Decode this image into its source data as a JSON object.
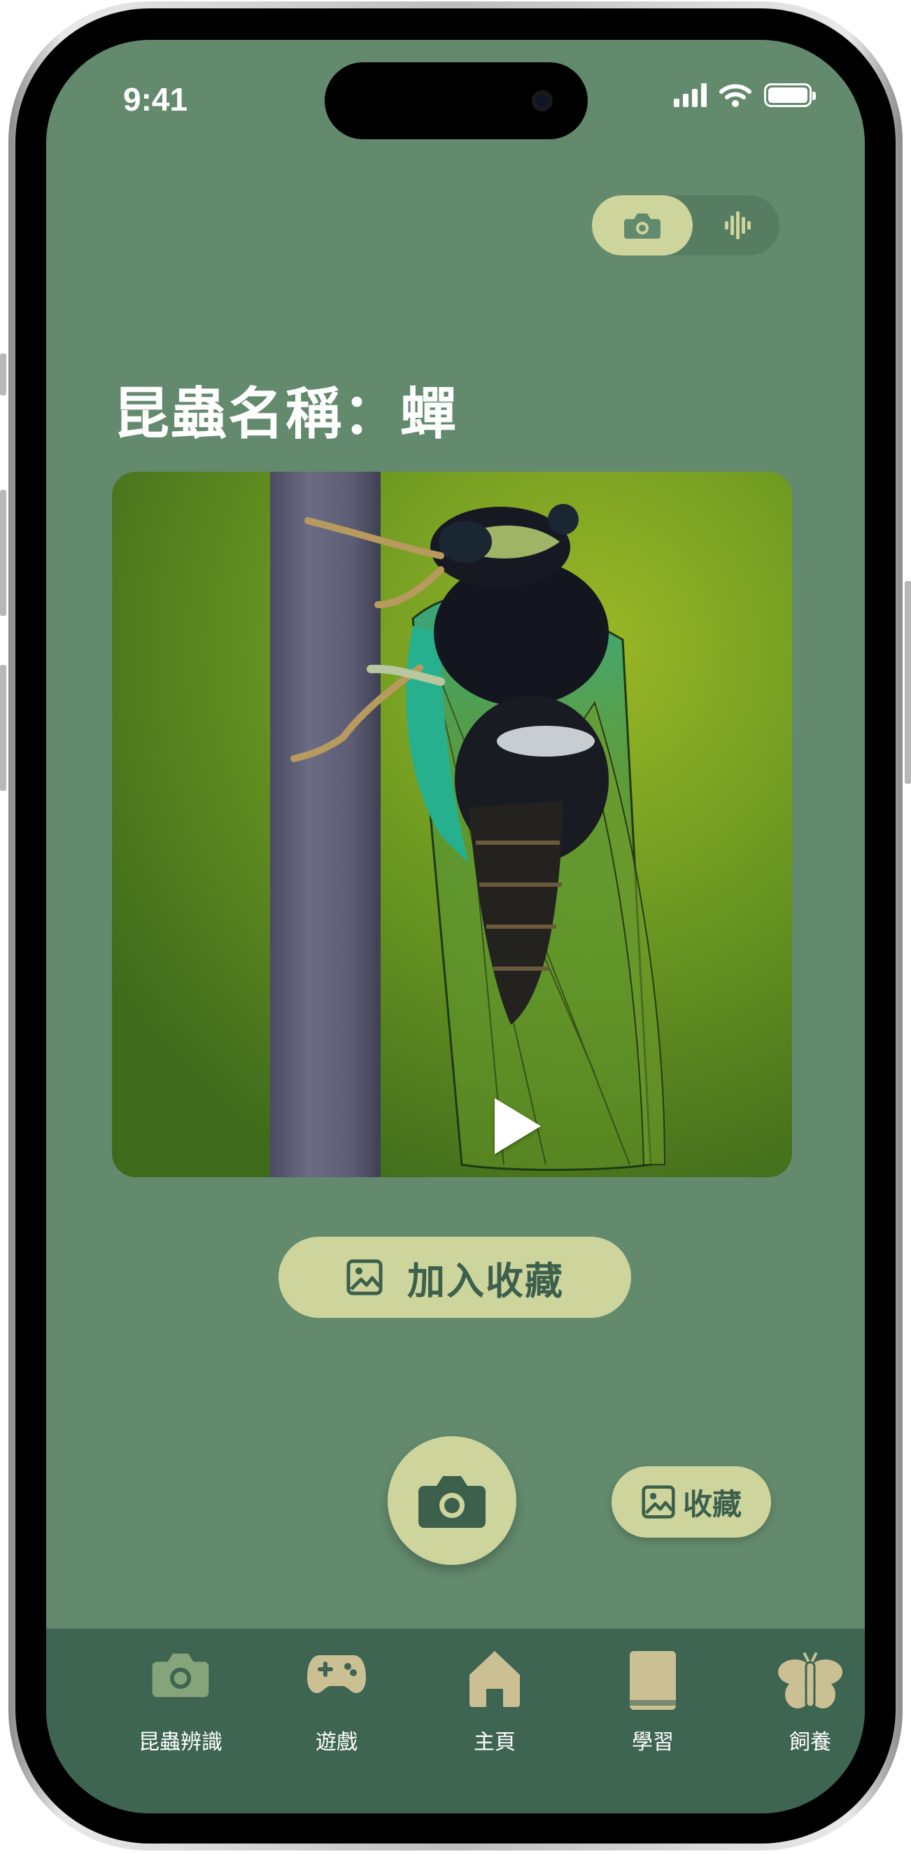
{
  "status_bar": {
    "time": "9:41"
  },
  "mode_toggle": {
    "camera_icon": "camera-icon",
    "sound_icon": "soundwave-icon",
    "active": "camera"
  },
  "result": {
    "title": "昆蟲名稱：蟬"
  },
  "actions": {
    "add_favorite_label": "加入收藏",
    "favorites_label": "收藏"
  },
  "tab_bar": {
    "items": [
      {
        "label": "昆蟲辨識",
        "icon": "camera-icon",
        "active": true
      },
      {
        "label": "遊戲",
        "icon": "gamepad-icon",
        "active": false
      },
      {
        "label": "主頁",
        "icon": "home-icon",
        "active": false
      },
      {
        "label": "學習",
        "icon": "book-icon",
        "active": false
      },
      {
        "label": "飼養",
        "icon": "butterfly-icon",
        "active": false
      }
    ]
  },
  "colors": {
    "background": "#638a6d",
    "accent": "#cdd59d",
    "accent_text": "#3d604d",
    "tab_bar": "#3e6452",
    "active_tab_icon": "#86a47a",
    "inactive_tab_icon": "#cbc094"
  }
}
